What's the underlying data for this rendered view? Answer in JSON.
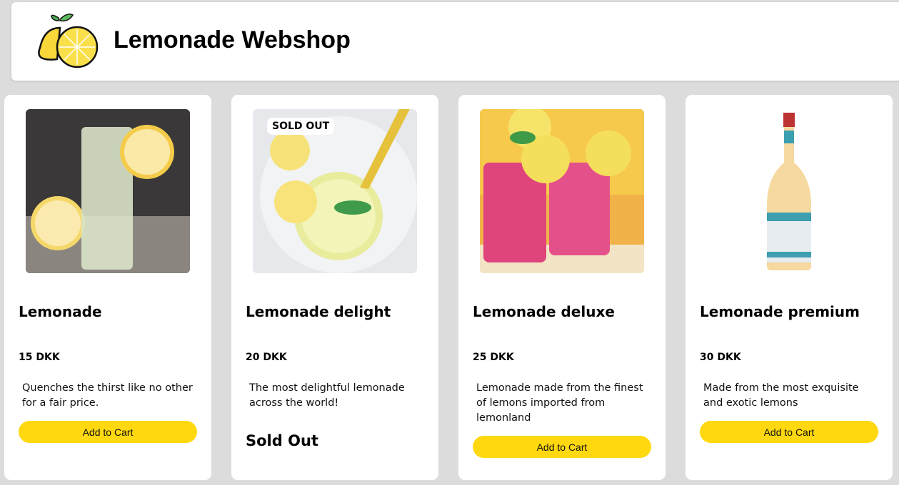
{
  "header": {
    "title": "Lemonade Webshop",
    "logo_icon": "lemon-logo-icon"
  },
  "colors": {
    "accent": "#ffd80f",
    "background": "#dcdcdc"
  },
  "products": [
    {
      "name": "Lemonade",
      "price": "15 DKK",
      "description": "Quenches the thirst like no other for a fair price.",
      "button": "Add to Cart"
    },
    {
      "name": "Lemonade delight",
      "price": "20 DKK",
      "description": "The most delightful lemonade across the world!",
      "badge": "SOLD OUT",
      "status": "Sold Out"
    },
    {
      "name": "Lemonade deluxe",
      "price": "25 DKK",
      "description": "Lemonade made from the finest of lemons imported from lemonland",
      "button": "Add to Cart"
    },
    {
      "name": "Lemonade premium",
      "price": "30 DKK",
      "description": "Made from the most exquisite and exotic lemons",
      "button": "Add to Cart"
    }
  ]
}
